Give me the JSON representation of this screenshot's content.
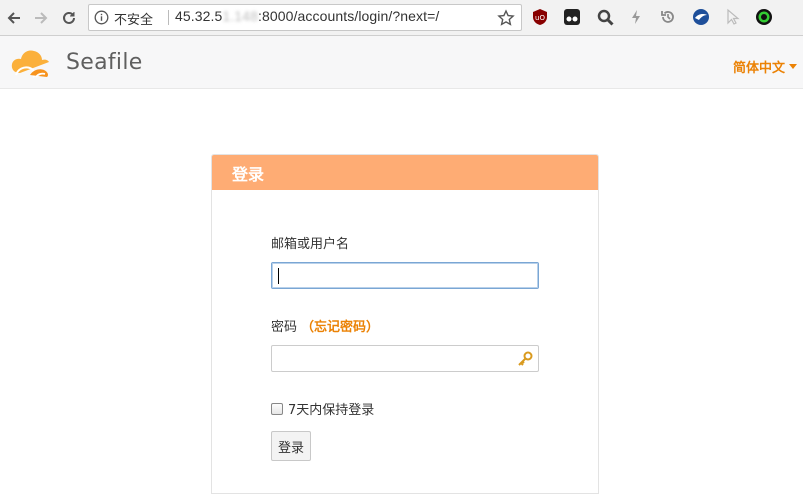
{
  "browser": {
    "security_label": "不安全",
    "url_prefix": "45.32.5",
    "url_blurred": "1.148",
    "url_suffix": ":8000/accounts/login/?next=/"
  },
  "header": {
    "logo_text": "Seafile",
    "language": "简体中文"
  },
  "login": {
    "title": "登录",
    "username_label": "邮箱或用户名",
    "username_value": "",
    "password_label": "密码",
    "forgot_password": "（忘记密码）",
    "password_value": "",
    "remember_label": "7天内保持登录",
    "remember_checked": false,
    "submit_label": "登录"
  },
  "colors": {
    "accent": "#eb8205",
    "panel_header": "#feac74"
  }
}
